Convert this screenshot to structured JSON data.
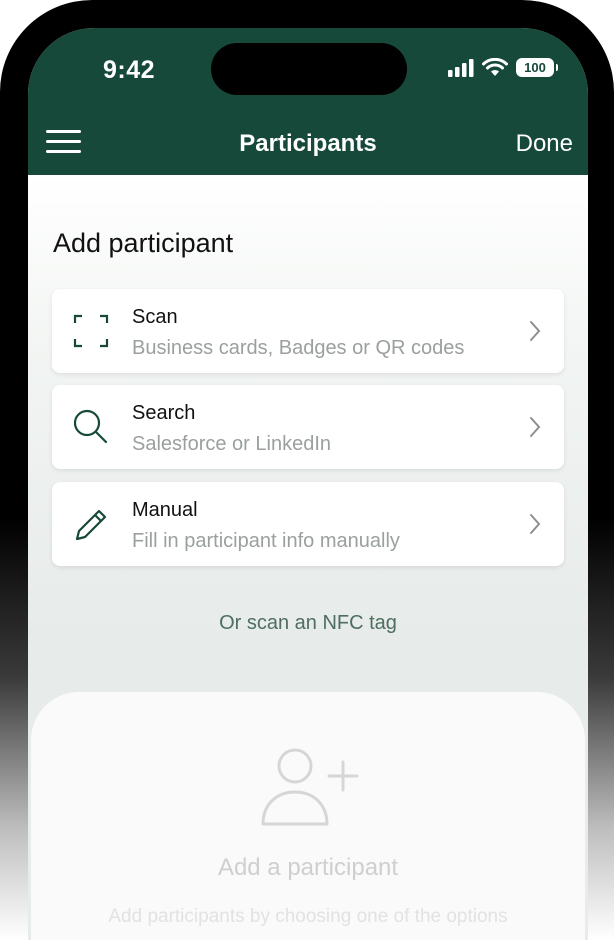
{
  "status_bar": {
    "time": "9:42",
    "battery": "100",
    "icons": [
      "cellular-signal-icon",
      "wifi-icon",
      "battery-icon"
    ]
  },
  "nav": {
    "title": "Participants",
    "done_label": "Done",
    "menu_icon": "hamburger-menu-icon"
  },
  "colors": {
    "brand_dark_green": "#17493a",
    "link_green": "#4e6e61",
    "subtitle_gray": "#9aa09d"
  },
  "main": {
    "section_title": "Add participant",
    "options": [
      {
        "label": "Scan",
        "sub": "Business cards, Badges or QR codes",
        "icon": "scan-frame-icon"
      },
      {
        "label": "Search",
        "sub": "Salesforce or LinkedIn",
        "icon": "search-icon"
      },
      {
        "label": "Manual",
        "sub": "Fill in participant info manually",
        "icon": "pencil-icon"
      }
    ],
    "nfc_label": "Or scan an NFC tag"
  },
  "empty_state": {
    "icon": "add-person-icon",
    "title": "Add a participant",
    "description": "Add participants by choosing one of the options"
  }
}
